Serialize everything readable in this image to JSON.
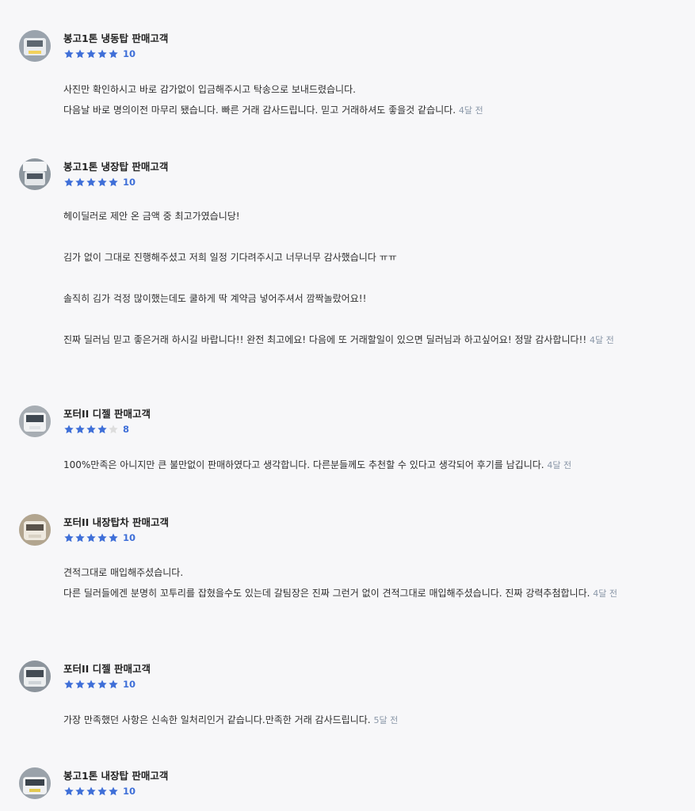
{
  "accent_color": "#3f6fd8",
  "star_color": "#3f6fd8",
  "star_empty_color": "#dddddd",
  "reviews": [
    {
      "title": "봉고1톤 냉동탑 판매고객",
      "stars": 5,
      "score": "10",
      "lines": [
        "사진만 확인하시고 바로 감가없이 입금해주시고 탁송으로 보내드렸습니다.",
        "다음날 바로 명의이전 마무리 됐습니다.  빠른 거래 감사드립니다. 믿고 거래하셔도 좋을것 같습니다."
      ],
      "time": "4달 전"
    },
    {
      "title": "봉고1톤 냉장탑 판매고객",
      "stars": 5,
      "score": "10",
      "lines": [
        "헤이딜러로 제안 온 금액 중 최고가였습니당!",
        "",
        "김가 없이 그대로 진행해주셨고 저희 일정 기다려주시고 너무너무 감사했습니다 ㅠㅠ",
        "",
        "솔직히 김가 걱정 많이했는데도 쿨하게 딱 계약금 넣어주셔서 깜짝놀랐어요!!",
        "",
        "진짜 딜러님 믿고 좋은거래 하시길 바랍니다!! 완전 최고에요! 다음에 또 거래할일이 있으면 딜러님과 하고싶어요! 정말 감사합니다!!"
      ],
      "time": "4달 전"
    },
    {
      "title": "포터II 디젤 판매고객",
      "stars": 4,
      "score": "8",
      "lines": [
        "100%만족은 아니지만 큰 불만없이 판매하였다고 생각합니다. 다른분들께도 추천할 수 있다고 생각되어 후기를 남깁니다."
      ],
      "time": "4달 전"
    },
    {
      "title": "포터II 내장탑차 판매고객",
      "stars": 5,
      "score": "10",
      "lines": [
        "견적그대로 매입해주셨습니다.",
        "다른 딜러들에겐 분명히 꼬투리를 잡혔을수도 있는데 갈팀장은 진짜 그런거 없이 견적그대로 매입해주셨습니다. 진짜 강력추첨합니다."
      ],
      "time": "4달 전"
    },
    {
      "title": "포터II 디젤 판매고객",
      "stars": 5,
      "score": "10",
      "lines": [
        "가장 만족했던 사항은 신속한 일처리인거 같습니다.만족한 거래 감사드립니다."
      ],
      "time": "5달 전"
    },
    {
      "title": "봉고1톤 내장탑 판매고객",
      "stars": 5,
      "score": "10",
      "lines": [],
      "time": ""
    }
  ]
}
